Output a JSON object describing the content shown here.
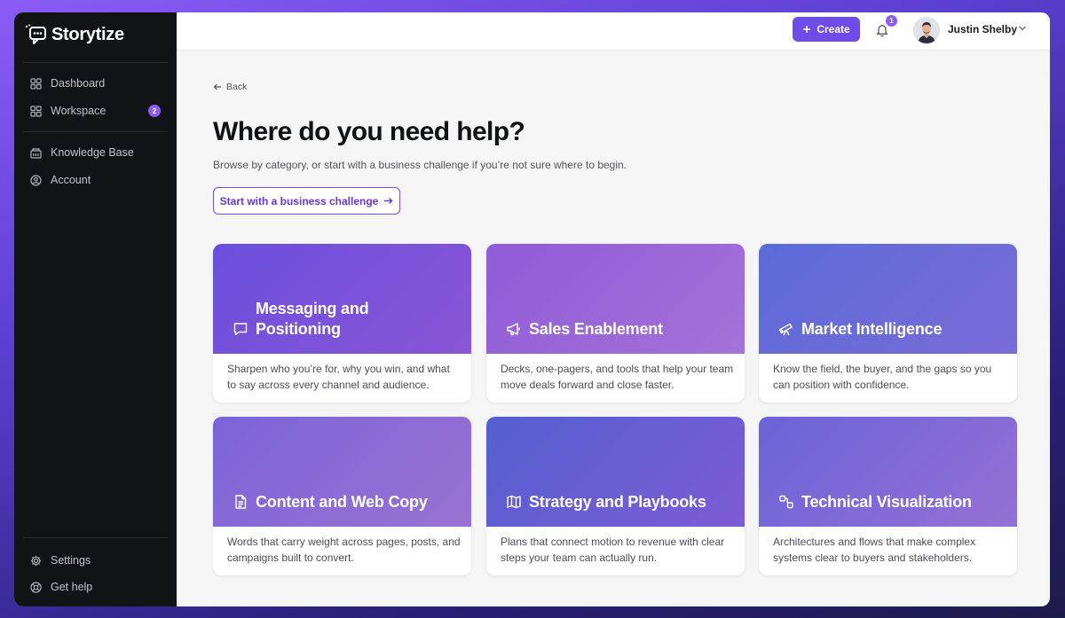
{
  "app": {
    "name": "Storytize"
  },
  "sidebar": {
    "items": [
      {
        "label": "Dashboard",
        "icon": "grid-icon"
      },
      {
        "label": "Workspace",
        "icon": "grid-icon",
        "badge": "2"
      },
      {
        "label": "Knowledge Base",
        "icon": "library-icon"
      },
      {
        "label": "Account",
        "icon": "user-circle-icon"
      }
    ],
    "footer": [
      {
        "label": "Settings",
        "icon": "gear-icon"
      },
      {
        "label": "Get help",
        "icon": "lifebuoy-icon"
      }
    ]
  },
  "topbar": {
    "create_label": "Create",
    "notification_count": "1",
    "user_name": "Justin Shelby"
  },
  "main": {
    "back_label": "Back",
    "title": "Where do you need help?",
    "subtitle": "Browse by category, or start with a business challenge if you’re not sure where to begin.",
    "challenge_button": "Start with a business challenge",
    "cards": [
      {
        "title": "Messaging and Positioning",
        "icon": "chat-icon",
        "description": "Sharpen who you’re for, why you win, and what to say across every channel and audience."
      },
      {
        "title": "Sales Enablement",
        "icon": "megaphone-icon",
        "description": "Decks, one-pagers, and tools that help your team move deals forward and close faster."
      },
      {
        "title": "Market Intelligence",
        "icon": "telescope-icon",
        "description": "Know the field, the buyer, and the gaps so you can position with confidence."
      },
      {
        "title": "Content and Web Copy",
        "icon": "document-icon",
        "description": "Words that carry weight across pages, posts, and campaigns built to convert."
      },
      {
        "title": "Strategy and Playbooks",
        "icon": "map-icon",
        "description": "Plans that connect motion to revenue with clear steps your team can actually run."
      },
      {
        "title": "Technical Visualization",
        "icon": "diagram-icon",
        "description": "Architectures and flows that make complex systems clear to buyers and stakeholders."
      }
    ]
  },
  "colors": {
    "accent": "#6d4ce8",
    "sidebar_bg": "#121316",
    "badge": "#8b5cf6"
  }
}
